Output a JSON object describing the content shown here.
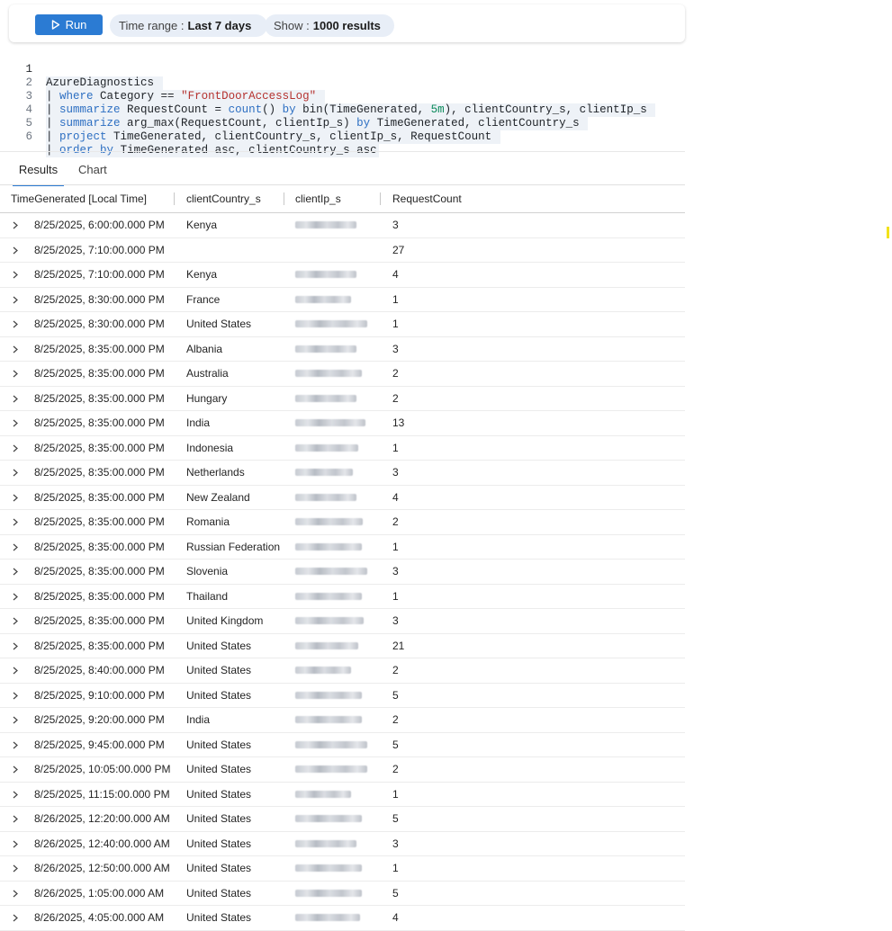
{
  "toolbar": {
    "run_label": "Run",
    "time_range_label": "Time range :",
    "time_range_value": "Last 7 days",
    "show_label": "Show :",
    "show_value": "1000 results"
  },
  "query": {
    "line_numbers": [
      "1",
      "2",
      "3",
      "4",
      "5",
      "6"
    ]
  },
  "tabs": {
    "results": "Results",
    "chart": "Chart"
  },
  "table": {
    "columns": [
      "TimeGenerated [Local Time]",
      "clientCountry_s",
      "clientIp_s",
      "RequestCount"
    ],
    "rows": [
      {
        "time": "8/25/2025, 6:00:00.000 PM",
        "country": "Kenya",
        "count": "3",
        "ip_w": 68
      },
      {
        "time": "8/25/2025, 7:10:00.000 PM",
        "country": "",
        "count": "27",
        "ip_w": 0
      },
      {
        "time": "8/25/2025, 7:10:00.000 PM",
        "country": "Kenya",
        "count": "4",
        "ip_w": 68
      },
      {
        "time": "8/25/2025, 8:30:00.000 PM",
        "country": "France",
        "count": "1",
        "ip_w": 62
      },
      {
        "time": "8/25/2025, 8:30:00.000 PM",
        "country": "United States",
        "count": "1",
        "ip_w": 80
      },
      {
        "time": "8/25/2025, 8:35:00.000 PM",
        "country": "Albania",
        "count": "3",
        "ip_w": 68
      },
      {
        "time": "8/25/2025, 8:35:00.000 PM",
        "country": "Australia",
        "count": "2",
        "ip_w": 74
      },
      {
        "time": "8/25/2025, 8:35:00.000 PM",
        "country": "Hungary",
        "count": "2",
        "ip_w": 68
      },
      {
        "time": "8/25/2025, 8:35:00.000 PM",
        "country": "India",
        "count": "13",
        "ip_w": 78
      },
      {
        "time": "8/25/2025, 8:35:00.000 PM",
        "country": "Indonesia",
        "count": "1",
        "ip_w": 70
      },
      {
        "time": "8/25/2025, 8:35:00.000 PM",
        "country": "Netherlands",
        "count": "3",
        "ip_w": 64
      },
      {
        "time": "8/25/2025, 8:35:00.000 PM",
        "country": "New Zealand",
        "count": "4",
        "ip_w": 68
      },
      {
        "time": "8/25/2025, 8:35:00.000 PM",
        "country": "Romania",
        "count": "2",
        "ip_w": 75
      },
      {
        "time": "8/25/2025, 8:35:00.000 PM",
        "country": "Russian Federation",
        "count": "1",
        "ip_w": 74
      },
      {
        "time": "8/25/2025, 8:35:00.000 PM",
        "country": "Slovenia",
        "count": "3",
        "ip_w": 80
      },
      {
        "time": "8/25/2025, 8:35:00.000 PM",
        "country": "Thailand",
        "count": "1",
        "ip_w": 74
      },
      {
        "time": "8/25/2025, 8:35:00.000 PM",
        "country": "United Kingdom",
        "count": "3",
        "ip_w": 76
      },
      {
        "time": "8/25/2025, 8:35:00.000 PM",
        "country": "United States",
        "count": "21",
        "ip_w": 70
      },
      {
        "time": "8/25/2025, 8:40:00.000 PM",
        "country": "United States",
        "count": "2",
        "ip_w": 62
      },
      {
        "time": "8/25/2025, 9:10:00.000 PM",
        "country": "United States",
        "count": "5",
        "ip_w": 74
      },
      {
        "time": "8/25/2025, 9:20:00.000 PM",
        "country": "India",
        "count": "2",
        "ip_w": 74
      },
      {
        "time": "8/25/2025, 9:45:00.000 PM",
        "country": "United States",
        "count": "5",
        "ip_w": 80
      },
      {
        "time": "8/25/2025, 10:05:00.000 PM",
        "country": "United States",
        "count": "2",
        "ip_w": 80
      },
      {
        "time": "8/25/2025, 11:15:00.000 PM",
        "country": "United States",
        "count": "1",
        "ip_w": 62
      },
      {
        "time": "8/26/2025, 12:20:00.000 AM",
        "country": "United States",
        "count": "5",
        "ip_w": 74
      },
      {
        "time": "8/26/2025, 12:40:00.000 AM",
        "country": "United States",
        "count": "3",
        "ip_w": 68
      },
      {
        "time": "8/26/2025, 12:50:00.000 AM",
        "country": "United States",
        "count": "1",
        "ip_w": 74
      },
      {
        "time": "8/26/2025, 1:05:00.000 AM",
        "country": "United States",
        "count": "5",
        "ip_w": 74
      },
      {
        "time": "8/26/2025, 4:05:00.000 AM",
        "country": "United States",
        "count": "4",
        "ip_w": 72
      }
    ]
  }
}
